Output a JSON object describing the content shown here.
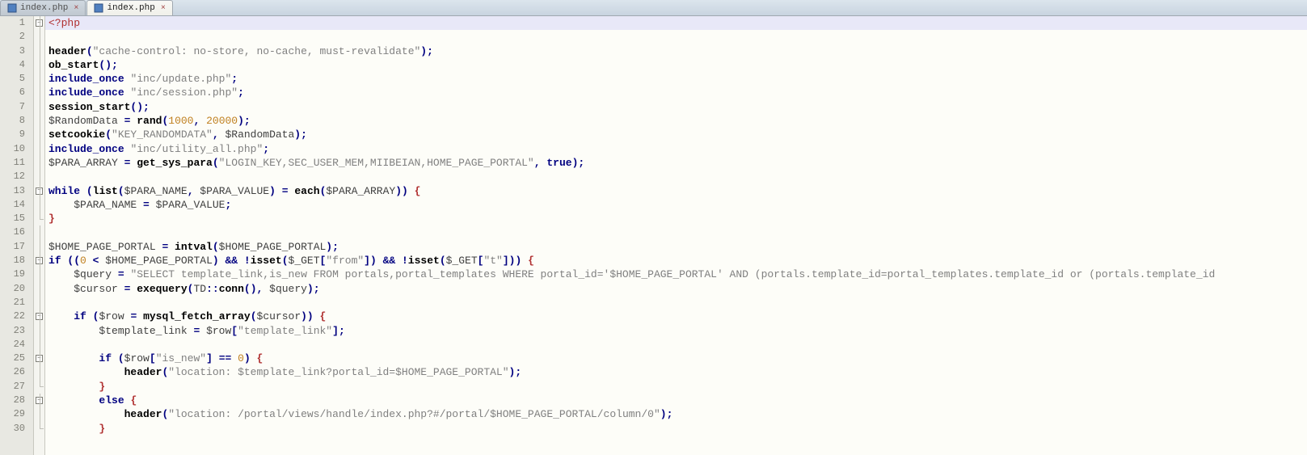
{
  "tabs": [
    {
      "name": "index.php",
      "active": false
    },
    {
      "name": "index.php",
      "active": true
    }
  ],
  "code": {
    "lines": [
      {
        "n": 1,
        "fold": "open",
        "hl": true,
        "tokens": [
          [
            "tag",
            "<?php"
          ]
        ]
      },
      {
        "n": 2,
        "fold": "line",
        "tokens": []
      },
      {
        "n": 3,
        "fold": "line",
        "tokens": [
          [
            "fn",
            "header"
          ],
          [
            "op",
            "("
          ],
          [
            "str",
            "\"cache-control: no-store, no-cache, must-revalidate\""
          ],
          [
            "op",
            ")"
          ],
          [
            "op",
            ";"
          ]
        ]
      },
      {
        "n": 4,
        "fold": "line",
        "tokens": [
          [
            "fn",
            "ob_start"
          ],
          [
            "op",
            "()"
          ],
          [
            "op",
            ";"
          ]
        ]
      },
      {
        "n": 5,
        "fold": "line",
        "tokens": [
          [
            "kw",
            "include_once"
          ],
          [
            "",
            " "
          ],
          [
            "str",
            "\"inc/update.php\""
          ],
          [
            "op",
            ";"
          ]
        ]
      },
      {
        "n": 6,
        "fold": "line",
        "tokens": [
          [
            "kw",
            "include_once"
          ],
          [
            "",
            " "
          ],
          [
            "str",
            "\"inc/session.php\""
          ],
          [
            "op",
            ";"
          ]
        ]
      },
      {
        "n": 7,
        "fold": "line",
        "tokens": [
          [
            "fn",
            "session_start"
          ],
          [
            "op",
            "()"
          ],
          [
            "op",
            ";"
          ]
        ]
      },
      {
        "n": 8,
        "fold": "line",
        "tokens": [
          [
            "var",
            "$RandomData "
          ],
          [
            "op",
            "= "
          ],
          [
            "fn",
            "rand"
          ],
          [
            "op",
            "("
          ],
          [
            "num",
            "1000"
          ],
          [
            "op",
            ", "
          ],
          [
            "num",
            "20000"
          ],
          [
            "op",
            ")"
          ],
          [
            "op",
            ";"
          ]
        ]
      },
      {
        "n": 9,
        "fold": "line",
        "tokens": [
          [
            "fn",
            "setcookie"
          ],
          [
            "op",
            "("
          ],
          [
            "str",
            "\"KEY_RANDOMDATA\""
          ],
          [
            "op",
            ", "
          ],
          [
            "var",
            "$RandomData"
          ],
          [
            "op",
            ")"
          ],
          [
            "op",
            ";"
          ]
        ]
      },
      {
        "n": 10,
        "fold": "line",
        "tokens": [
          [
            "kw",
            "include_once"
          ],
          [
            "",
            " "
          ],
          [
            "str",
            "\"inc/utility_all.php\""
          ],
          [
            "op",
            ";"
          ]
        ]
      },
      {
        "n": 11,
        "fold": "line",
        "tokens": [
          [
            "var",
            "$PARA_ARRAY "
          ],
          [
            "op",
            "= "
          ],
          [
            "fn",
            "get_sys_para"
          ],
          [
            "op",
            "("
          ],
          [
            "str",
            "\"LOGIN_KEY,SEC_USER_MEM,MIIBEIAN,HOME_PAGE_PORTAL\""
          ],
          [
            "op",
            ", "
          ],
          [
            "kw",
            "true"
          ],
          [
            "op",
            ")"
          ],
          [
            "op",
            ";"
          ]
        ]
      },
      {
        "n": 12,
        "fold": "line",
        "tokens": []
      },
      {
        "n": 13,
        "fold": "open",
        "tokens": [
          [
            "kw",
            "while"
          ],
          [
            "",
            " "
          ],
          [
            "op",
            "("
          ],
          [
            "fn",
            "list"
          ],
          [
            "op",
            "("
          ],
          [
            "var",
            "$PARA_NAME"
          ],
          [
            "op",
            ", "
          ],
          [
            "var",
            "$PARA_VALUE"
          ],
          [
            "op",
            ") "
          ],
          [
            "op",
            "= "
          ],
          [
            "fn",
            "each"
          ],
          [
            "op",
            "("
          ],
          [
            "var",
            "$PARA_ARRAY"
          ],
          [
            "op",
            ")) "
          ],
          [
            "br",
            "{"
          ]
        ]
      },
      {
        "n": 14,
        "fold": "line",
        "indent": 1,
        "tokens": [
          [
            "var",
            "$PARA_NAME "
          ],
          [
            "op",
            "= "
          ],
          [
            "var",
            "$PARA_VALUE"
          ],
          [
            "op",
            ";"
          ]
        ]
      },
      {
        "n": 15,
        "fold": "end",
        "tokens": [
          [
            "br",
            "}"
          ]
        ]
      },
      {
        "n": 16,
        "fold": "line",
        "tokens": []
      },
      {
        "n": 17,
        "fold": "line",
        "tokens": [
          [
            "var",
            "$HOME_PAGE_PORTAL "
          ],
          [
            "op",
            "= "
          ],
          [
            "fn",
            "intval"
          ],
          [
            "op",
            "("
          ],
          [
            "var",
            "$HOME_PAGE_PORTAL"
          ],
          [
            "op",
            ")"
          ],
          [
            "op",
            ";"
          ]
        ]
      },
      {
        "n": 18,
        "fold": "open",
        "tokens": [
          [
            "kw",
            "if"
          ],
          [
            "",
            " "
          ],
          [
            "op",
            "(("
          ],
          [
            "num",
            "0"
          ],
          [
            "op",
            " < "
          ],
          [
            "var",
            "$HOME_PAGE_PORTAL"
          ],
          [
            "op",
            ") "
          ],
          [
            "op",
            "&& !"
          ],
          [
            "fn",
            "isset"
          ],
          [
            "op",
            "("
          ],
          [
            "var",
            "$_GET"
          ],
          [
            "op",
            "["
          ],
          [
            "str",
            "\"from\""
          ],
          [
            "op",
            "]) "
          ],
          [
            "op",
            "&& !"
          ],
          [
            "fn",
            "isset"
          ],
          [
            "op",
            "("
          ],
          [
            "var",
            "$_GET"
          ],
          [
            "op",
            "["
          ],
          [
            "str",
            "\"t\""
          ],
          [
            "op",
            "])) "
          ],
          [
            "br",
            "{"
          ]
        ]
      },
      {
        "n": 19,
        "fold": "line",
        "indent": 1,
        "tokens": [
          [
            "var",
            "$query "
          ],
          [
            "op",
            "= "
          ],
          [
            "str",
            "\"SELECT template_link,is_new FROM portals,portal_templates WHERE portal_id='$HOME_PAGE_PORTAL' AND (portals.template_id=portal_templates.template_id or (portals.template_id"
          ]
        ]
      },
      {
        "n": 20,
        "fold": "line",
        "indent": 1,
        "tokens": [
          [
            "var",
            "$cursor "
          ],
          [
            "op",
            "= "
          ],
          [
            "fn",
            "exequery"
          ],
          [
            "op",
            "("
          ],
          [
            "var",
            "TD"
          ],
          [
            "op",
            "::"
          ],
          [
            "fn",
            "conn"
          ],
          [
            "op",
            "(), "
          ],
          [
            "var",
            "$query"
          ],
          [
            "op",
            ")"
          ],
          [
            "op",
            ";"
          ]
        ]
      },
      {
        "n": 21,
        "fold": "line",
        "tokens": []
      },
      {
        "n": 22,
        "fold": "open",
        "indent": 1,
        "tokens": [
          [
            "kw",
            "if"
          ],
          [
            "",
            " "
          ],
          [
            "op",
            "("
          ],
          [
            "var",
            "$row "
          ],
          [
            "op",
            "= "
          ],
          [
            "fn",
            "mysql_fetch_array"
          ],
          [
            "op",
            "("
          ],
          [
            "var",
            "$cursor"
          ],
          [
            "op",
            ")) "
          ],
          [
            "br",
            "{"
          ]
        ]
      },
      {
        "n": 23,
        "fold": "line",
        "indent": 2,
        "tokens": [
          [
            "var",
            "$template_link "
          ],
          [
            "op",
            "= "
          ],
          [
            "var",
            "$row"
          ],
          [
            "op",
            "["
          ],
          [
            "str",
            "\"template_link\""
          ],
          [
            "op",
            "]"
          ],
          [
            "op",
            ";"
          ]
        ]
      },
      {
        "n": 24,
        "fold": "line",
        "tokens": []
      },
      {
        "n": 25,
        "fold": "open",
        "indent": 2,
        "tokens": [
          [
            "kw",
            "if"
          ],
          [
            "",
            " "
          ],
          [
            "op",
            "("
          ],
          [
            "var",
            "$row"
          ],
          [
            "op",
            "["
          ],
          [
            "str",
            "\"is_new\""
          ],
          [
            "op",
            "] "
          ],
          [
            "op",
            "== "
          ],
          [
            "num",
            "0"
          ],
          [
            "op",
            ") "
          ],
          [
            "br",
            "{"
          ]
        ]
      },
      {
        "n": 26,
        "fold": "line",
        "indent": 3,
        "tokens": [
          [
            "fn",
            "header"
          ],
          [
            "op",
            "("
          ],
          [
            "str",
            "\"location: $template_link?portal_id=$HOME_PAGE_PORTAL\""
          ],
          [
            "op",
            ")"
          ],
          [
            "op",
            ";"
          ]
        ]
      },
      {
        "n": 27,
        "fold": "end",
        "indent": 2,
        "tokens": [
          [
            "br",
            "}"
          ]
        ]
      },
      {
        "n": 28,
        "fold": "open",
        "indent": 2,
        "tokens": [
          [
            "kw",
            "else"
          ],
          [
            "",
            " "
          ],
          [
            "br",
            "{"
          ]
        ]
      },
      {
        "n": 29,
        "fold": "line",
        "indent": 3,
        "tokens": [
          [
            "fn",
            "header"
          ],
          [
            "op",
            "("
          ],
          [
            "str",
            "\"location: /portal/views/handle/index.php?#/portal/$HOME_PAGE_PORTAL/column/0\""
          ],
          [
            "op",
            ")"
          ],
          [
            "op",
            ";"
          ]
        ]
      },
      {
        "n": 30,
        "fold": "end",
        "indent": 2,
        "tokens": [
          [
            "br",
            "}"
          ]
        ]
      }
    ]
  }
}
